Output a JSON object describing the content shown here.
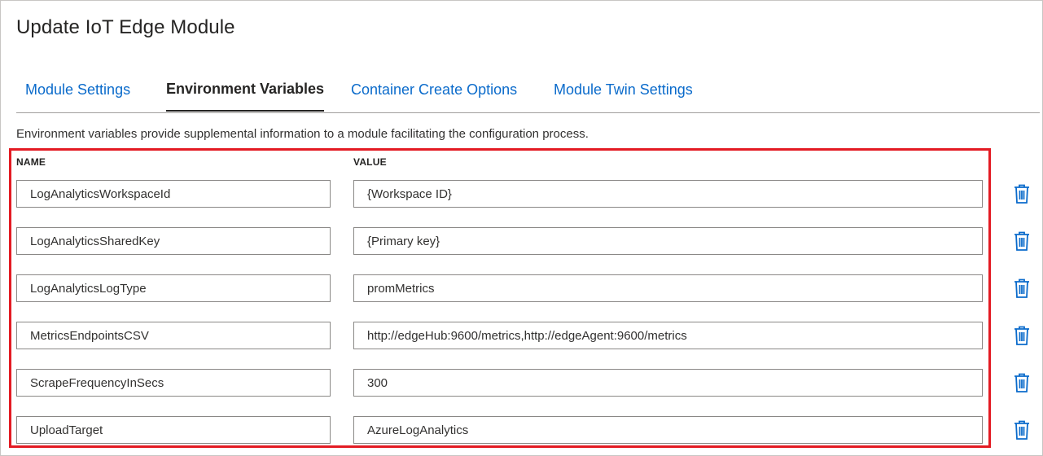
{
  "page": {
    "title": "Update IoT Edge Module"
  },
  "tabs": [
    {
      "label": "Module Settings",
      "active": false
    },
    {
      "label": "Environment Variables",
      "active": true
    },
    {
      "label": "Container Create Options",
      "active": false
    },
    {
      "label": "Module Twin Settings",
      "active": false
    }
  ],
  "description": "Environment variables provide supplemental information to a module facilitating the configuration process.",
  "columns": {
    "name": "NAME",
    "value": "VALUE"
  },
  "variables": [
    {
      "name": "LogAnalyticsWorkspaceId",
      "value": "{Workspace ID}"
    },
    {
      "name": "LogAnalyticsSharedKey",
      "value": "{Primary key}"
    },
    {
      "name": "LogAnalyticsLogType",
      "value": "promMetrics"
    },
    {
      "name": "MetricsEndpointsCSV",
      "value": "http://edgeHub:9600/metrics,http://edgeAgent:9600/metrics"
    },
    {
      "name": "ScrapeFrequencyInSecs",
      "value": "300"
    },
    {
      "name": "UploadTarget",
      "value": "AzureLogAnalytics"
    }
  ],
  "icons": {
    "delete": "trash-icon"
  },
  "colors": {
    "link": "#0b6bcb",
    "highlight": "#e31b23",
    "delete_icon": "#0b6bcb"
  }
}
